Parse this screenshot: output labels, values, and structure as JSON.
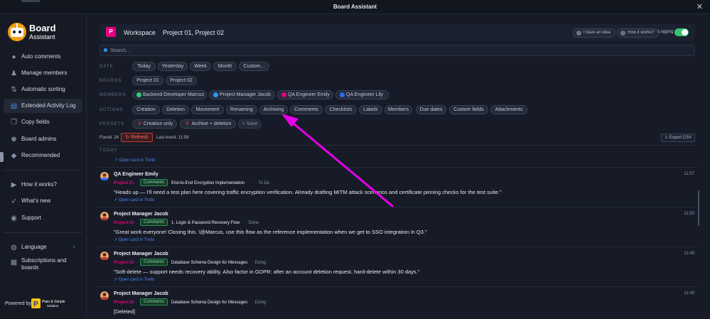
{
  "window": {
    "title": "Board Assistant",
    "close_icon": "close-icon"
  },
  "brand": {
    "line1": "Board",
    "line2": "Assistant"
  },
  "sidebar": {
    "items": [
      {
        "label": "Auto comments",
        "icon": "chat-bubble-icon"
      },
      {
        "label": "Manage members",
        "icon": "users-icon"
      },
      {
        "label": "Automatic sorting",
        "icon": "sort-arrows-icon"
      },
      {
        "label": "Extended Activity Log",
        "icon": "document-icon",
        "active": true
      },
      {
        "label": "Copy fields",
        "icon": "copy-icon"
      },
      {
        "label": "Board admins",
        "icon": "admin-user-icon"
      },
      {
        "label": "Recommended",
        "icon": "diamond-icon"
      }
    ],
    "help_items": [
      {
        "label": "How it works?",
        "icon": "video-icon"
      },
      {
        "label": "What's new",
        "icon": "rocket-icon"
      },
      {
        "label": "Support",
        "icon": "support-icon"
      }
    ],
    "settings_items": [
      {
        "label": "Language",
        "icon": "globe-icon"
      },
      {
        "label": "Subscriptions and",
        "label2": "boards",
        "icon": "card-stack-icon"
      }
    ],
    "powered_by": "Powered by",
    "partner_logo": {
      "line1": "Plain & Simple",
      "line2": "Solution"
    }
  },
  "workspace": {
    "badge": "P",
    "label": "Workspace",
    "projects": "Project 01, Project 02",
    "idea_button": "I have an idea",
    "how_button": "How it works?",
    "logging_label": "Logging",
    "logging_on": true
  },
  "search": {
    "placeholder": "Search..."
  },
  "filters": {
    "date": {
      "label": "DATE",
      "options": [
        "Today",
        "Yesterday",
        "Week",
        "Month",
        "Custom..."
      ]
    },
    "boards": {
      "label": "BOARDS",
      "options": [
        "Project 01",
        "Project 02"
      ]
    },
    "members": {
      "label": "MEMBERS",
      "options": [
        {
          "name": "Backend Developer Marcus",
          "color": "#2ecc71"
        },
        {
          "name": "Project Manager Jacob",
          "color": "#2b9bf4"
        },
        {
          "name": "QA Engineer Emily",
          "color": "#e6007e"
        },
        {
          "name": "QA Engineer Lily",
          "color": "#2b6cf4"
        }
      ]
    },
    "actions": {
      "label": "ACTIONS",
      "options": [
        "Creation",
        "Deletion",
        "Movement",
        "Renaming",
        "Archiving",
        "Comments",
        "Checklists",
        "Labels",
        "Members",
        "Due dates",
        "Custom fields",
        "Attachments"
      ]
    },
    "presets": {
      "label": "PRESETS",
      "options": [
        "Creation only",
        "Archive + deletion"
      ],
      "save": "+ Save"
    }
  },
  "status": {
    "found": "Found: 24",
    "refresh": "↻ Refresh",
    "last_event": "Last event: 11:59",
    "export": "⇩ Export CSV"
  },
  "feed": {
    "group_label": "TODAY",
    "open_card": "↗ Open card in Trello",
    "entries": [
      {
        "author": "QA Engineer Emily",
        "time": "11:57",
        "project": "Project 01",
        "type": "Comments",
        "card": "End-to-End Encryption Implementation",
        "status": "To Do",
        "message": "\"Heads up — I'll need a test plan here covering traffic encryption verification. Already drafting MITM attack scenarios and certificate pinning checks for the test suite.\"",
        "link": "↗ Open card in Trello"
      },
      {
        "author": "Project Manager Jacob",
        "time": "11:50",
        "project": "Project 01",
        "type": "Comments",
        "card": "1. Login & Password Recovery Flow",
        "status": "Done",
        "message": "\"Great work everyone! Closing this. \\@Marcus, use this flow as the reference implementation when we get to SSO integration in Q3.\"",
        "link": "↗ Open card in Trello"
      },
      {
        "author": "Project Manager Jacob",
        "time": "11:49",
        "project": "Project 01",
        "type": "Comments",
        "card": "Database Schema Design for Messages",
        "status": "Doing",
        "message": "\"Soft-delete — support needs recovery ability. Also factor in GDPR: after an account deletion request, hard-delete within 30 days.\"",
        "link": "↗ Open card in Trello"
      },
      {
        "author": "Project Manager Jacob",
        "time": "11:49",
        "project": "Project 01",
        "type": "Comments",
        "card": "Database Schema Design for Messages",
        "status": "Doing",
        "message": "[Deleted]",
        "link": ""
      }
    ]
  },
  "colors": {
    "accent": "#e6007e",
    "annotation_arrow": "#e600e6",
    "toggle_on": "#36c46e"
  }
}
